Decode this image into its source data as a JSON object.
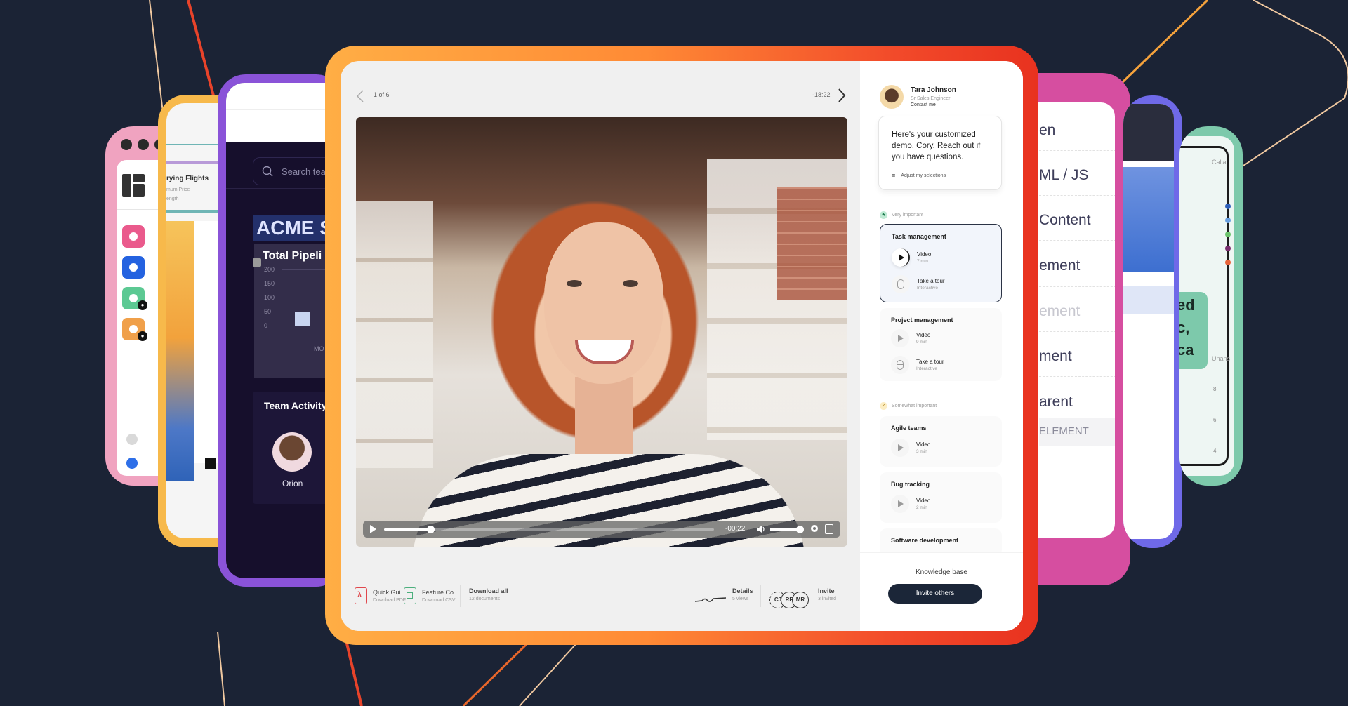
{
  "background": {
    "color": "#1b2335"
  },
  "cards": {
    "pink": {
      "frame_color": "#f0a3c0",
      "app_icon_colors": [
        "#ea5a8c",
        "#2462e0",
        "#5cc993",
        "#f0a04a"
      ],
      "locked_indices": [
        2,
        3
      ],
      "bottom_dot_colors": [
        "#d9d9d9",
        "#2e6fe8"
      ]
    },
    "yellow": {
      "frame_color": "#f7b94b",
      "title": "rying Flights",
      "subtitles": [
        "mum Price",
        "ength"
      ]
    },
    "purple": {
      "frame_color": "#8a53d8",
      "search_placeholder": "Search tea",
      "heading": "ACME S",
      "chart_title": "Total Pipeli",
      "chart_ticks": [
        "200",
        "150",
        "100",
        "50",
        "0"
      ],
      "chart_x_label": "MO",
      "chart_bar_value": 50,
      "team_title": "Team Activity",
      "member_name": "Orion"
    },
    "magenta": {
      "frame_color": "#d64ea0",
      "items": [
        "en",
        "ML / JS",
        "Content",
        "ement",
        "ement",
        "ment",
        "arent"
      ],
      "footer": "ELEMENT"
    },
    "indigo": {
      "frame_color": "#6f69e8"
    },
    "green": {
      "frame_color": "#7dc9ab",
      "header_label": "Callat",
      "callout_lines": [
        "ed",
        "c,",
        "ca"
      ],
      "axis_label": "Unans",
      "ticks": [
        "8",
        "6",
        "4"
      ],
      "dot_colors": [
        "#2e5fb8",
        "#6aa0e0",
        "#6cc36c",
        "#7a2f6f",
        "#e7643b"
      ]
    }
  },
  "main": {
    "frame_gradient": [
      "#ffae45",
      "#ff8a35",
      "#f24a2a",
      "#e8321f"
    ],
    "topbar": {
      "page_indicator": "1 of 6",
      "time_remaining": "-18:22"
    },
    "video": {
      "player_time": "-00:22",
      "progress_fraction": 0.14,
      "volume_fraction": 0.95
    },
    "bottom": {
      "docs": [
        {
          "title": "Quick Gui...",
          "subtitle": "Download PDF",
          "icon": "pdf-icon",
          "color": "#e0474c"
        },
        {
          "title": "Feature Co...",
          "subtitle": "Download CSV",
          "icon": "spreadsheet-icon",
          "color": "#4caf7d"
        }
      ],
      "download_all": {
        "title": "Download all",
        "subtitle": "12 documents"
      },
      "details": {
        "title": "Details",
        "subtitle": "5 views"
      },
      "avatars": [
        "CJ",
        "RF",
        "MR"
      ],
      "invite": {
        "title": "Invite",
        "subtitle": "3 invited"
      }
    },
    "sidebar": {
      "presenter": {
        "name": "Tara Johnson",
        "role": "Sr Sales Engineer",
        "contact": "Contact me"
      },
      "message": "Here's your customized demo, Cory. Reach out if you have questions.",
      "adjust_label": "Adjust my selections",
      "groups": [
        {
          "label": "Very important",
          "color": "#3fbf7f",
          "topics": [
            {
              "title": "Task management",
              "active": true,
              "items": [
                {
                  "label": "Video",
                  "sub": "7 min",
                  "type": "video"
                },
                {
                  "label": "Take a tour",
                  "sub": "Interactive",
                  "type": "tour"
                }
              ]
            },
            {
              "title": "Project management",
              "active": false,
              "items": [
                {
                  "label": "Video",
                  "sub": "9 min",
                  "type": "video"
                },
                {
                  "label": "Take a tour",
                  "sub": "Interactive",
                  "type": "tour"
                }
              ]
            }
          ]
        },
        {
          "label": "Somewhat important",
          "color": "#f5c84a",
          "topics": [
            {
              "title": "Agile teams",
              "active": false,
              "items": [
                {
                  "label": "Video",
                  "sub": "3 min",
                  "type": "video"
                }
              ]
            },
            {
              "title": "Bug tracking",
              "active": false,
              "items": [
                {
                  "label": "Video",
                  "sub": "2 min",
                  "type": "video"
                }
              ]
            },
            {
              "title": "Software development",
              "active": false,
              "items": []
            }
          ]
        }
      ],
      "knowledge_base": "Knowledge base",
      "invite_button": "Invite others"
    }
  }
}
